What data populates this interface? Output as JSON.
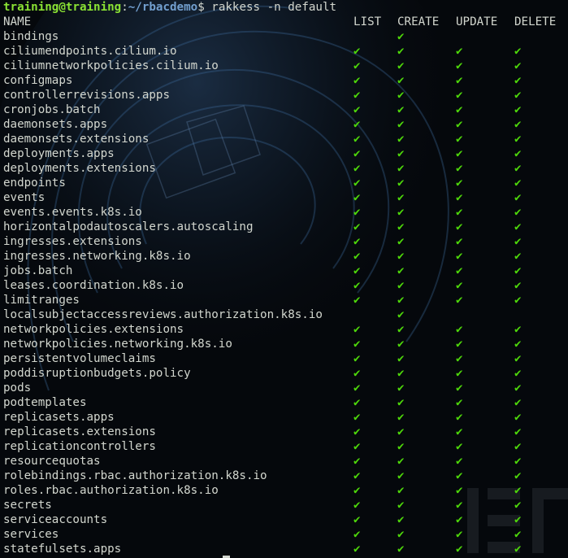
{
  "prompt": {
    "user_host": "training@training",
    "sep": ":",
    "path": "~/rbacdemo",
    "dollar": "$",
    "command": " rakkess -n default"
  },
  "columns": [
    "NAME",
    "LIST",
    "CREATE",
    "UPDATE",
    "DELETE"
  ],
  "check_symbol": "✔",
  "check_color": "#4ed80a",
  "rows": [
    {
      "name": "bindings",
      "perm": [
        false,
        true,
        false,
        false
      ]
    },
    {
      "name": "ciliumendpoints.cilium.io",
      "perm": [
        true,
        true,
        true,
        true
      ]
    },
    {
      "name": "ciliumnetworkpolicies.cilium.io",
      "perm": [
        true,
        true,
        true,
        true
      ]
    },
    {
      "name": "configmaps",
      "perm": [
        true,
        true,
        true,
        true
      ]
    },
    {
      "name": "controllerrevisions.apps",
      "perm": [
        true,
        true,
        true,
        true
      ]
    },
    {
      "name": "cronjobs.batch",
      "perm": [
        true,
        true,
        true,
        true
      ]
    },
    {
      "name": "daemonsets.apps",
      "perm": [
        true,
        true,
        true,
        true
      ]
    },
    {
      "name": "daemonsets.extensions",
      "perm": [
        true,
        true,
        true,
        true
      ]
    },
    {
      "name": "deployments.apps",
      "perm": [
        true,
        true,
        true,
        true
      ]
    },
    {
      "name": "deployments.extensions",
      "perm": [
        true,
        true,
        true,
        true
      ]
    },
    {
      "name": "endpoints",
      "perm": [
        true,
        true,
        true,
        true
      ]
    },
    {
      "name": "events",
      "perm": [
        true,
        true,
        true,
        true
      ]
    },
    {
      "name": "events.events.k8s.io",
      "perm": [
        true,
        true,
        true,
        true
      ]
    },
    {
      "name": "horizontalpodautoscalers.autoscaling",
      "perm": [
        true,
        true,
        true,
        true
      ]
    },
    {
      "name": "ingresses.extensions",
      "perm": [
        true,
        true,
        true,
        true
      ]
    },
    {
      "name": "ingresses.networking.k8s.io",
      "perm": [
        true,
        true,
        true,
        true
      ]
    },
    {
      "name": "jobs.batch",
      "perm": [
        true,
        true,
        true,
        true
      ]
    },
    {
      "name": "leases.coordination.k8s.io",
      "perm": [
        true,
        true,
        true,
        true
      ]
    },
    {
      "name": "limitranges",
      "perm": [
        true,
        true,
        true,
        true
      ]
    },
    {
      "name": "localsubjectaccessreviews.authorization.k8s.io",
      "perm": [
        false,
        true,
        false,
        false
      ]
    },
    {
      "name": "networkpolicies.extensions",
      "perm": [
        true,
        true,
        true,
        true
      ]
    },
    {
      "name": "networkpolicies.networking.k8s.io",
      "perm": [
        true,
        true,
        true,
        true
      ]
    },
    {
      "name": "persistentvolumeclaims",
      "perm": [
        true,
        true,
        true,
        true
      ]
    },
    {
      "name": "poddisruptionbudgets.policy",
      "perm": [
        true,
        true,
        true,
        true
      ]
    },
    {
      "name": "pods",
      "perm": [
        true,
        true,
        true,
        true
      ]
    },
    {
      "name": "podtemplates",
      "perm": [
        true,
        true,
        true,
        true
      ]
    },
    {
      "name": "replicasets.apps",
      "perm": [
        true,
        true,
        true,
        true
      ]
    },
    {
      "name": "replicasets.extensions",
      "perm": [
        true,
        true,
        true,
        true
      ]
    },
    {
      "name": "replicationcontrollers",
      "perm": [
        true,
        true,
        true,
        true
      ]
    },
    {
      "name": "resourcequotas",
      "perm": [
        true,
        true,
        true,
        true
      ]
    },
    {
      "name": "rolebindings.rbac.authorization.k8s.io",
      "perm": [
        true,
        true,
        true,
        true
      ]
    },
    {
      "name": "roles.rbac.authorization.k8s.io",
      "perm": [
        true,
        true,
        true,
        true
      ]
    },
    {
      "name": "secrets",
      "perm": [
        true,
        true,
        true,
        true
      ]
    },
    {
      "name": "serviceaccounts",
      "perm": [
        true,
        true,
        true,
        true
      ]
    },
    {
      "name": "services",
      "perm": [
        true,
        true,
        true,
        true
      ]
    },
    {
      "name": "statefulsets.apps",
      "perm": [
        true,
        true,
        true,
        true
      ]
    }
  ]
}
